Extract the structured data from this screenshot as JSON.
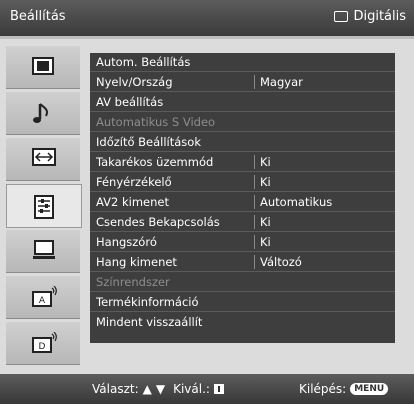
{
  "header": {
    "title": "Beállítás",
    "source": "Digitális"
  },
  "menu": [
    {
      "label": "Autom. Beállítás",
      "value": "",
      "disabled": false
    },
    {
      "label": "Nyelv/Ország",
      "value": "Magyar",
      "disabled": false
    },
    {
      "label": "AV beállítás",
      "value": "",
      "disabled": false
    },
    {
      "label": "Automatikus S Video",
      "value": "",
      "disabled": true
    },
    {
      "label": "Időzítő Beállítások",
      "value": "",
      "disabled": false
    },
    {
      "label": "Takarékos üzemmód",
      "value": "Ki",
      "disabled": false
    },
    {
      "label": "Fényérzékelő",
      "value": "Ki",
      "disabled": false
    },
    {
      "label": "AV2 kimenet",
      "value": "Automatikus",
      "disabled": false
    },
    {
      "label": "Csendes Bekapcsolás",
      "value": "Ki",
      "disabled": false
    },
    {
      "label": "Hangszóró",
      "value": "Ki",
      "disabled": false
    },
    {
      "label": "Hang kimenet",
      "value": "Változó",
      "disabled": false
    },
    {
      "label": "Színrendszer",
      "value": "",
      "disabled": true
    },
    {
      "label": "Termékinformáció",
      "value": "",
      "disabled": false
    },
    {
      "label": "Mindent visszaállít",
      "value": "",
      "disabled": false
    }
  ],
  "sidebar": [
    {
      "icon": "picture-icon"
    },
    {
      "icon": "sound-note-icon"
    },
    {
      "icon": "screen-aspect-icon"
    },
    {
      "icon": "settings-icon"
    },
    {
      "icon": "pc-monitor-icon"
    },
    {
      "icon": "analog-setup-icon"
    },
    {
      "icon": "digital-setup-icon"
    }
  ],
  "footer": {
    "select_label": "Választ:",
    "ok_label": "Kivál.:",
    "exit_label": "Kilépés:",
    "menu_button": "MENU"
  },
  "colors": {
    "bar": "#444444",
    "panel": "#3e3e3e",
    "disabled_text": "#8d8d8d"
  }
}
